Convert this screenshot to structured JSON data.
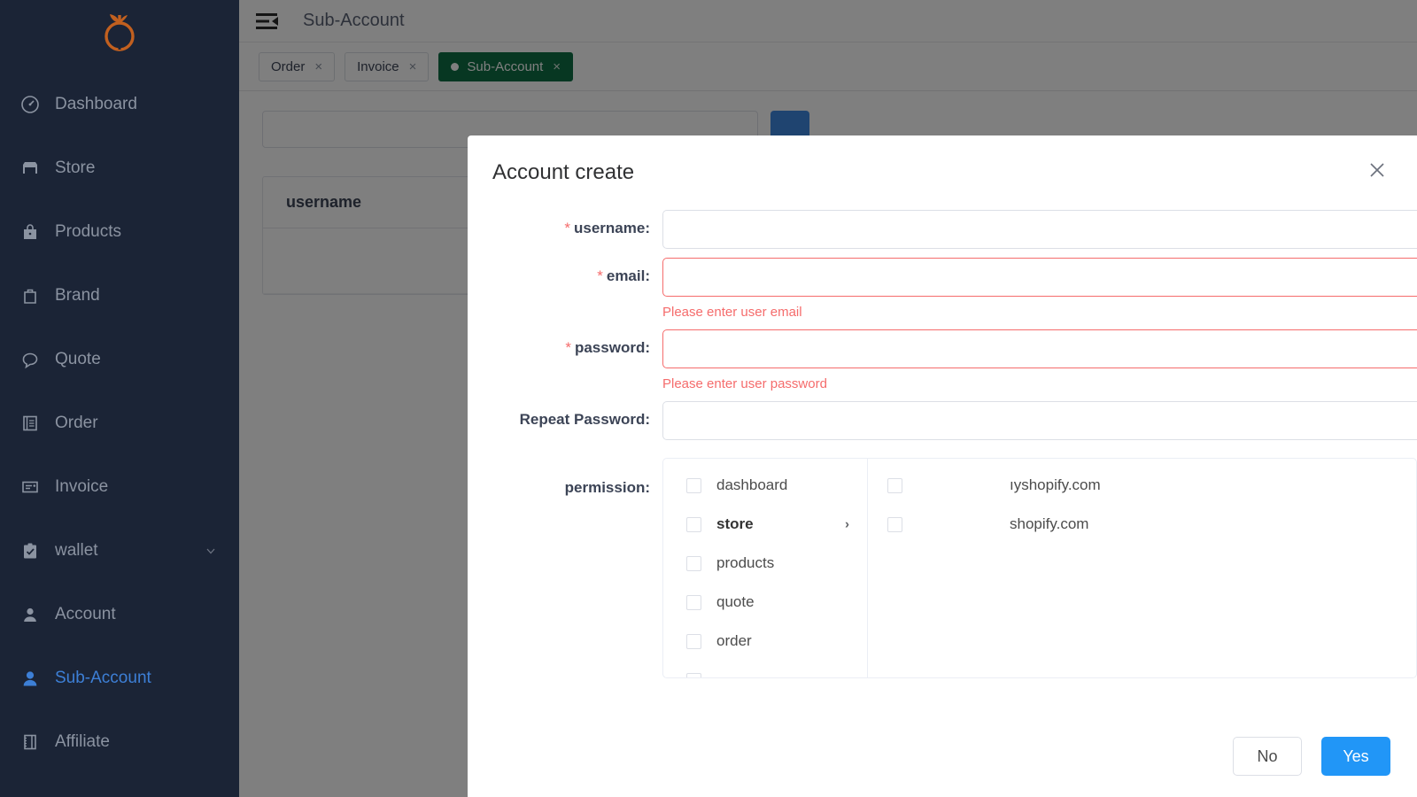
{
  "brand": {
    "logo_icon": "pomegranate-logo",
    "logo_color": "#c2601f"
  },
  "sidebar": {
    "items": [
      {
        "label": "Dashboard",
        "icon": "dashboard-icon",
        "active": false,
        "caret": false
      },
      {
        "label": "Store",
        "icon": "store-icon",
        "active": false,
        "caret": false
      },
      {
        "label": "Products",
        "icon": "products-icon",
        "active": false,
        "caret": false
      },
      {
        "label": "Brand",
        "icon": "brand-bag-icon",
        "active": false,
        "caret": false
      },
      {
        "label": "Quote",
        "icon": "quote-chat-icon",
        "active": false,
        "caret": false
      },
      {
        "label": "Order",
        "icon": "order-book-icon",
        "active": false,
        "caret": false
      },
      {
        "label": "Invoice",
        "icon": "invoice-icon",
        "active": false,
        "caret": false
      },
      {
        "label": "wallet",
        "icon": "wallet-clipboard-icon",
        "active": false,
        "caret": true
      },
      {
        "label": "Account",
        "icon": "account-user-icon",
        "active": false,
        "caret": false
      },
      {
        "label": "Sub-Account",
        "icon": "sub-account-user-icon",
        "active": true,
        "caret": false
      },
      {
        "label": "Affiliate",
        "icon": "affiliate-book-icon",
        "active": false,
        "caret": false
      }
    ],
    "active_color": "#3d7fd6",
    "background": "#1b2436"
  },
  "topbar": {
    "menu_icon": "collapse-menu-icon",
    "title": "Sub-Account"
  },
  "tabs": {
    "items": [
      {
        "label": "Order",
        "active": false,
        "close": "×"
      },
      {
        "label": "Invoice",
        "active": false,
        "close": "×"
      },
      {
        "label": "Sub-Account",
        "active": true,
        "close": "×"
      }
    ],
    "active_color": "#0f6f45"
  },
  "background_page": {
    "search_placeholder": "",
    "add_button_label": "",
    "table": {
      "columns": [
        "username"
      ],
      "rows": [
        [
          ""
        ]
      ]
    }
  },
  "modal": {
    "title": "Account create",
    "close_icon": "close-icon",
    "fields": [
      {
        "key": "username",
        "label": "username:",
        "required": true,
        "value": "",
        "placeholder": "",
        "error": ""
      },
      {
        "key": "email",
        "label": "email:",
        "required": true,
        "value": "",
        "placeholder": "",
        "error": "Please enter user email"
      },
      {
        "key": "password",
        "label": "password:",
        "required": true,
        "value": "",
        "placeholder": "",
        "error": "Please enter user password"
      },
      {
        "key": "repeat_password",
        "label": "Repeat Password:",
        "required": false,
        "value": "",
        "placeholder": "",
        "error": ""
      }
    ],
    "permission": {
      "label": "permission:",
      "left_items": [
        {
          "label": "dashboard",
          "checked": false,
          "expandable": false,
          "bold": false
        },
        {
          "label": "store",
          "checked": false,
          "expandable": true,
          "bold": true,
          "arrow": "›"
        },
        {
          "label": "products",
          "checked": false,
          "expandable": false,
          "bold": false
        },
        {
          "label": "quote",
          "checked": false,
          "expandable": false,
          "bold": false
        },
        {
          "label": "order",
          "checked": false,
          "expandable": false,
          "bold": false
        }
      ],
      "right_items": [
        {
          "label": "ıyshopify.com",
          "checked": false
        },
        {
          "label": "shopify.com",
          "checked": false
        }
      ]
    },
    "footer": {
      "cancel_label": "No",
      "confirm_label": "Yes",
      "confirm_color": "#2196f7"
    }
  }
}
